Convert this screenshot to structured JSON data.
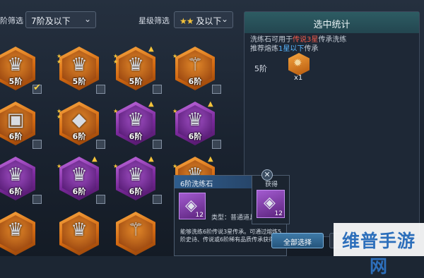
{
  "filters": {
    "tier_label_partial": "阶筛选",
    "tier_value": "7阶及以下",
    "star_label": "星级筛选",
    "star_value_stars": "★★",
    "star_value_text": "及以下"
  },
  "grid": {
    "items": [
      {
        "tier": "5阶",
        "color": "orange",
        "icon": "crown-icon",
        "checked": true
      },
      {
        "tier": "5阶",
        "color": "orange",
        "icon": "crown-icon",
        "checked": false
      },
      {
        "tier": "5阶",
        "color": "orange",
        "icon": "crown-icon",
        "checked": false
      },
      {
        "tier": "6阶",
        "color": "orange",
        "icon": "horn-icon",
        "checked": false
      },
      {
        "tier": "6阶",
        "color": "orange",
        "icon": "chest-icon",
        "checked": false
      },
      {
        "tier": "6阶",
        "color": "orange",
        "icon": "stone-icon",
        "checked": false
      },
      {
        "tier": "6阶",
        "color": "purple",
        "icon": "crown-icon",
        "checked": false
      },
      {
        "tier": "6阶",
        "color": "purple",
        "icon": "crown-icon",
        "checked": false
      },
      {
        "tier": "6阶",
        "color": "purple",
        "icon": "crown-icon",
        "checked": false
      },
      {
        "tier": "6阶",
        "color": "purple",
        "icon": "crown-icon",
        "checked": false
      },
      {
        "tier": "6阶",
        "color": "purple",
        "icon": "crown-icon",
        "checked": false
      },
      {
        "tier": "6阶",
        "color": "orange",
        "icon": "crown-icon",
        "checked": false
      }
    ]
  },
  "panel": {
    "title": "选中统计",
    "line1_pre": "洗练石可用于",
    "line1_hl": "传说3星",
    "line1_post": "传承洗练",
    "line2_pre": "推荐熔炼",
    "line2_hl": "1星以下",
    "line2_post": "传承",
    "tier_label": "5阶",
    "count": "x1"
  },
  "popup": {
    "title": "6阶洗练石",
    "icon_count": "12",
    "type_label": "类型：普通道具",
    "description": "能够洗练6阶传说3星传承。可通过熔炼5阶史诗、传说或6阶稀有品质传承获得"
  },
  "popup2": {
    "title_partial": "获得",
    "icon_count": "12"
  },
  "buttons": {
    "select_all": "全部选择"
  },
  "watermark": {
    "text": "维普手游网"
  },
  "colors": {
    "orange_hex": "#d46a12",
    "purple_hex": "#7b2a9c",
    "panel_title_bg": "#2d5c63",
    "highlight_red": "#f15a4a",
    "highlight_blue": "#58b6ff"
  }
}
